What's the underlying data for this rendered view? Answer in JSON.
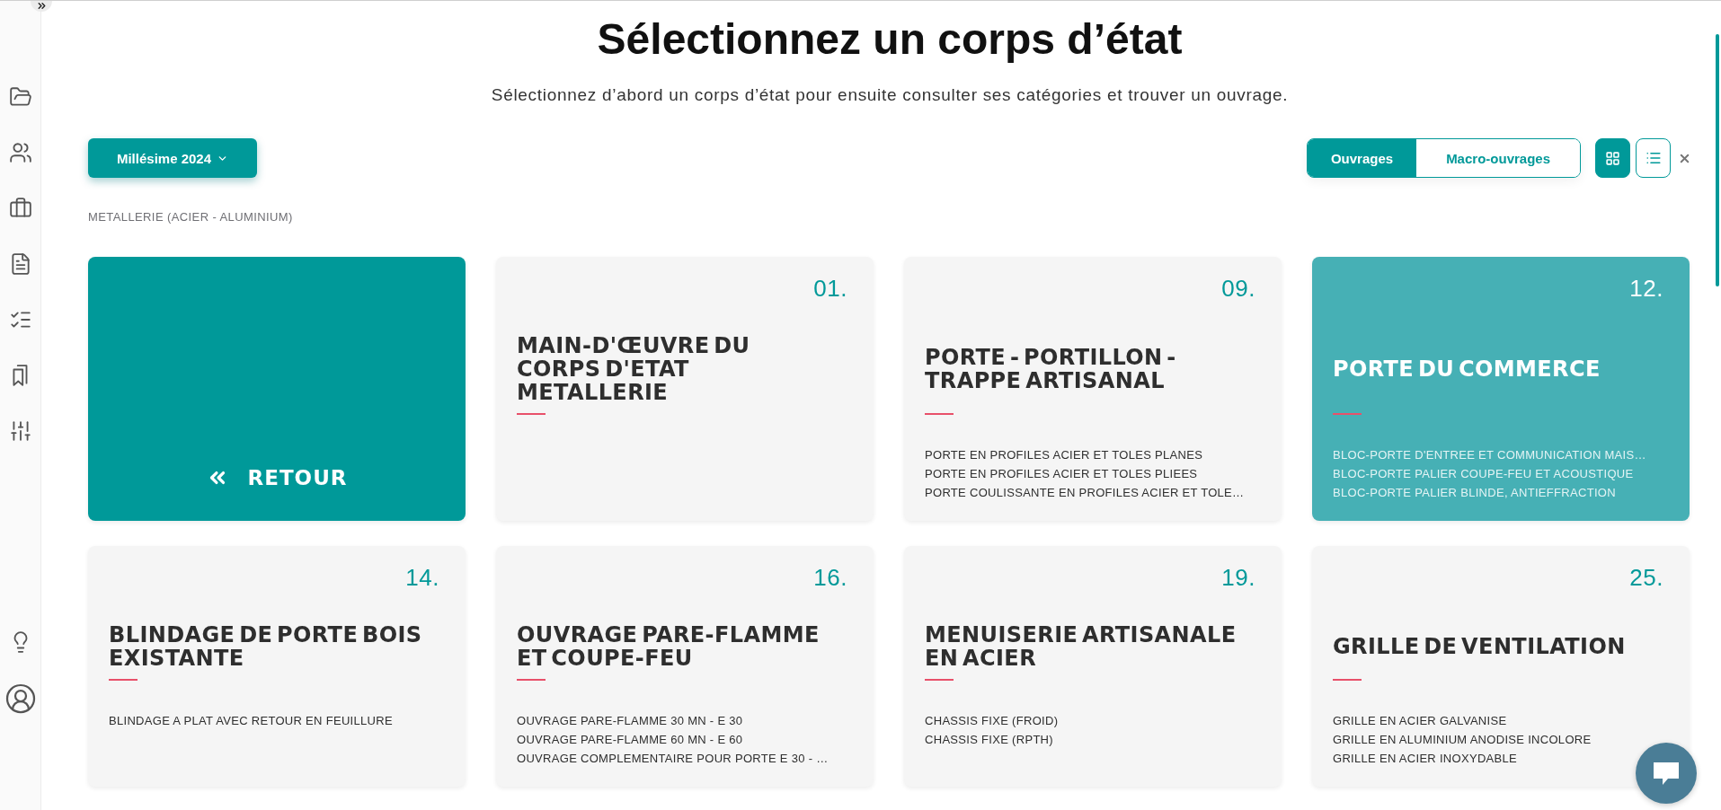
{
  "page": {
    "title": "Sélectionnez un corps d’état",
    "subtitle": "Sélectionnez d’abord un corps d’état pour ensuite consulter ses catégories et trouver un ouvrage."
  },
  "toolbar": {
    "year_button": "Millésime 2024",
    "mode_tabs": [
      {
        "label": "Ouvrages",
        "selected": true
      },
      {
        "label": "Macro-ouvrages",
        "selected": false
      }
    ],
    "view_buttons": [
      {
        "kind": "grid",
        "selected": true
      },
      {
        "kind": "list",
        "selected": false
      }
    ]
  },
  "breadcrumb": "METALLERIE (ACIER - ALUMINIUM)",
  "back_tile": {
    "label": "RETOUR"
  },
  "categories": [
    {
      "number": "01.",
      "title": "MAIN-D'ŒUVRE DU CORPS D'ETAT METALLERIE",
      "selected": false
    },
    {
      "number": "09.",
      "title": "PORTE - PORTILLON - TRAPPE ARTISANAL",
      "selected": false,
      "items": [
        "PORTE EN PROFILES ACIER ET TOLES PLANES",
        "PORTE EN PROFILES ACIER ET TOLES PLIEES",
        "PORTE COULISSANTE EN PROFILES ACIER ET TOLE…"
      ]
    },
    {
      "number": "12.",
      "title": "PORTE DU COMMERCE",
      "selected": true,
      "items": [
        "BLOC-PORTE D'ENTREE ET COMMUNICATION MAIS…",
        "BLOC-PORTE PALIER COUPE-FEU ET ACOUSTIQUE",
        "BLOC-PORTE PALIER BLINDE, ANTIEFFRACTION"
      ]
    },
    {
      "number": "14.",
      "title": "BLINDAGE DE PORTE BOIS EXISTANTE",
      "selected": false,
      "items": [
        "BLINDAGE A PLAT AVEC RETOUR EN FEUILLURE"
      ]
    },
    {
      "number": "16.",
      "title": "OUVRAGE PARE-FLAMME ET COUPE-FEU",
      "selected": false,
      "items": [
        "OUVRAGE PARE-FLAMME 30 MN - E 30",
        "OUVRAGE PARE-FLAMME 60 MN - E 60",
        "OUVRAGE COMPLEMENTAIRE POUR PORTE E 30 - …"
      ]
    },
    {
      "number": "19.",
      "title": "MENUISERIE ARTISANALE EN ACIER",
      "selected": false,
      "items": [
        "CHASSIS FIXE (FROID)",
        "CHASSIS FIXE (RPTH)"
      ]
    },
    {
      "number": "25.",
      "title": "GRILLE DE VENTILATION",
      "selected": false,
      "items": [
        "GRILLE EN ACIER GALVANISE",
        "GRILLE EN ALUMINIUM ANODISE INCOLORE",
        "GRILLE EN ACIER INOXYDABLE"
      ]
    }
  ]
}
